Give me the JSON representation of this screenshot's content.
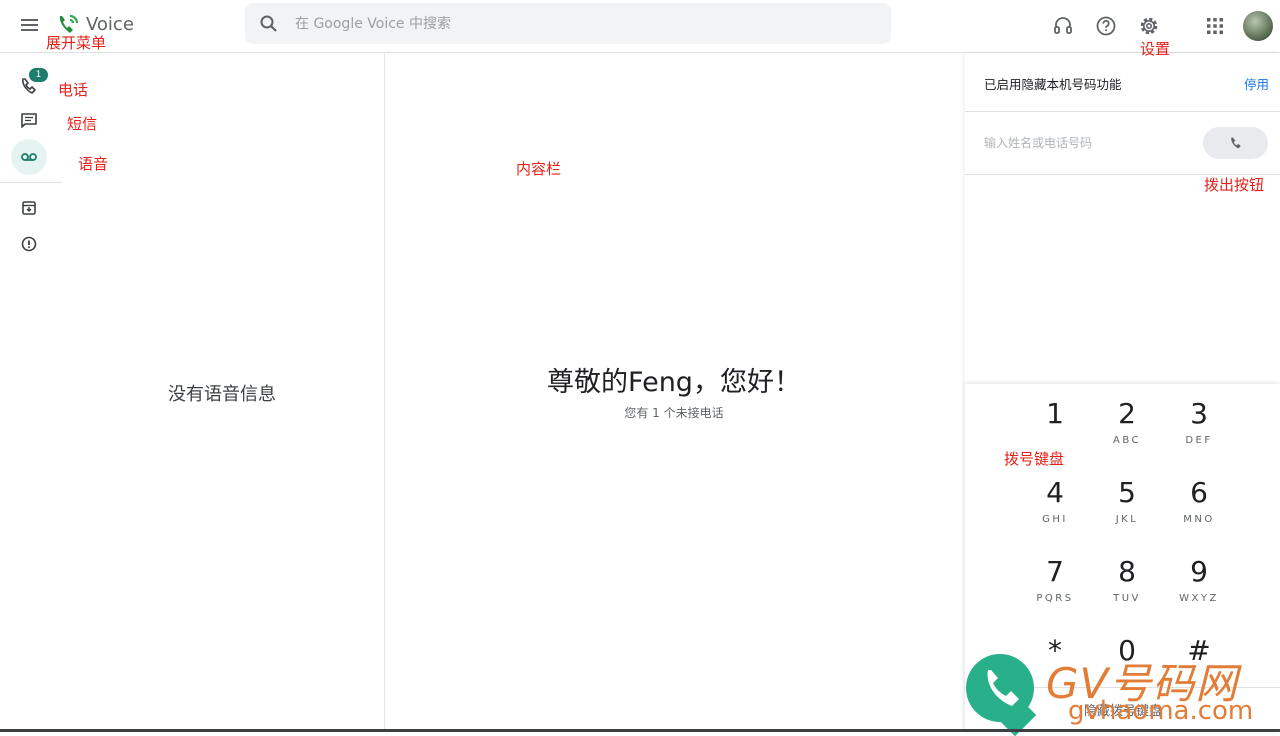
{
  "header": {
    "app_name": "Voice",
    "search_placeholder": "在 Google Voice 中搜索",
    "icons": [
      "menu-icon",
      "voice-logo-icon",
      "search-icon",
      "headset-icon",
      "help-icon",
      "settings-icon",
      "apps-icon"
    ]
  },
  "annotations": {
    "menu": "展开菜单",
    "settings": "设置",
    "calls": "电话",
    "messages": "短信",
    "voicemail": "语音",
    "content": "内容栏",
    "dial_button": "拨出按钮",
    "keypad": "拨号键盘"
  },
  "rail": {
    "calls_badge": "1",
    "items": [
      "phone-icon",
      "message-icon",
      "voicemail-icon",
      "archive-icon",
      "spam-icon"
    ],
    "active": "voicemail-icon"
  },
  "list_pane": {
    "empty_text": "没有语音信息"
  },
  "main": {
    "greeting": "尊敬的Feng，您好！",
    "missed": "您有 1 个未接电话"
  },
  "dialer": {
    "hide_status": "已启用隐藏本机号码功能",
    "disable_link": "停用",
    "input_placeholder": "输入姓名或电话号码",
    "keys": [
      {
        "digit": "1",
        "letters": ""
      },
      {
        "digit": "2",
        "letters": "ABC"
      },
      {
        "digit": "3",
        "letters": "DEF"
      },
      {
        "digit": "4",
        "letters": "GHI"
      },
      {
        "digit": "5",
        "letters": "JKL"
      },
      {
        "digit": "6",
        "letters": "MNO"
      },
      {
        "digit": "7",
        "letters": "PQRS"
      },
      {
        "digit": "8",
        "letters": "TUV"
      },
      {
        "digit": "9",
        "letters": "WXYZ"
      },
      {
        "digit": "*",
        "letters": ""
      },
      {
        "digit": "0",
        "letters": ""
      },
      {
        "digit": "#",
        "letters": ""
      }
    ],
    "hide_keypad": "隐藏拨号键盘"
  },
  "watermark": {
    "brand": "GV号码网",
    "site": "gvhaoma.com"
  },
  "colors": {
    "accent": "#1e7d6b",
    "link": "#1a73e8",
    "annotation": "#e8201a",
    "watermark_orange": "#e37c37",
    "watermark_green": "#27b08a"
  }
}
